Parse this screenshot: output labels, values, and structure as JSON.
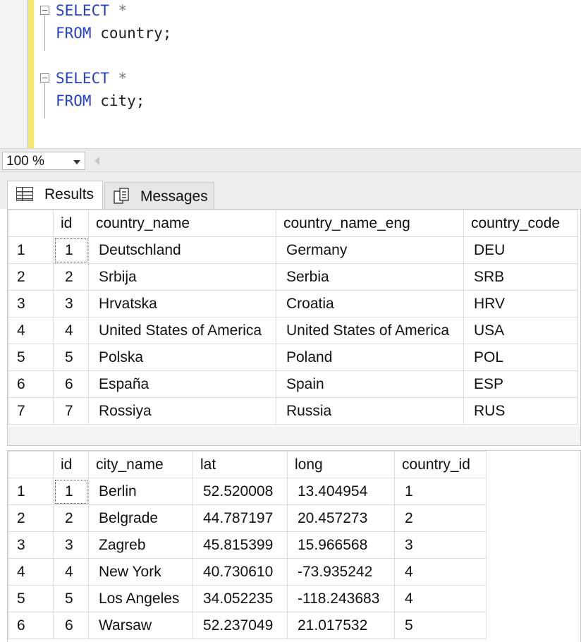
{
  "editor": {
    "lines": [
      {
        "keyword": "SELECT",
        "rest": " *"
      },
      {
        "keyword": "FROM",
        "rest": " country;"
      },
      {
        "keyword": "SELECT",
        "rest": " *"
      },
      {
        "keyword": "FROM",
        "rest": " city;"
      }
    ]
  },
  "zoom": {
    "value": "100 %"
  },
  "tabs": {
    "results": "Results",
    "messages": "Messages"
  },
  "country_table": {
    "columns": [
      "",
      "id",
      "country_name",
      "country_name_eng",
      "country_code"
    ],
    "rows": [
      [
        "1",
        "1",
        "Deutschland",
        "Germany",
        "DEU"
      ],
      [
        "2",
        "2",
        "Srbija",
        "Serbia",
        "SRB"
      ],
      [
        "3",
        "3",
        "Hrvatska",
        "Croatia",
        "HRV"
      ],
      [
        "4",
        "4",
        "United States of America",
        "United States of America",
        "USA"
      ],
      [
        "5",
        "5",
        "Polska",
        "Poland",
        "POL"
      ],
      [
        "6",
        "6",
        "España",
        "Spain",
        "ESP"
      ],
      [
        "7",
        "7",
        "Rossiya",
        "Russia",
        "RUS"
      ]
    ]
  },
  "city_table": {
    "columns": [
      "",
      "id",
      "city_name",
      "lat",
      "long",
      "country_id"
    ],
    "rows": [
      [
        "1",
        "1",
        "Berlin",
        "52.520008",
        "13.404954",
        "1"
      ],
      [
        "2",
        "2",
        "Belgrade",
        "44.787197",
        "20.457273",
        "2"
      ],
      [
        "3",
        "3",
        "Zagreb",
        "45.815399",
        "15.966568",
        "3"
      ],
      [
        "4",
        "4",
        "New York",
        "40.730610",
        "-73.935242",
        "4"
      ],
      [
        "5",
        "5",
        "Los Angeles",
        "34.052235",
        "-118.243683",
        "4"
      ],
      [
        "6",
        "6",
        "Warsaw",
        "52.237049",
        "21.017532",
        "5"
      ]
    ]
  }
}
